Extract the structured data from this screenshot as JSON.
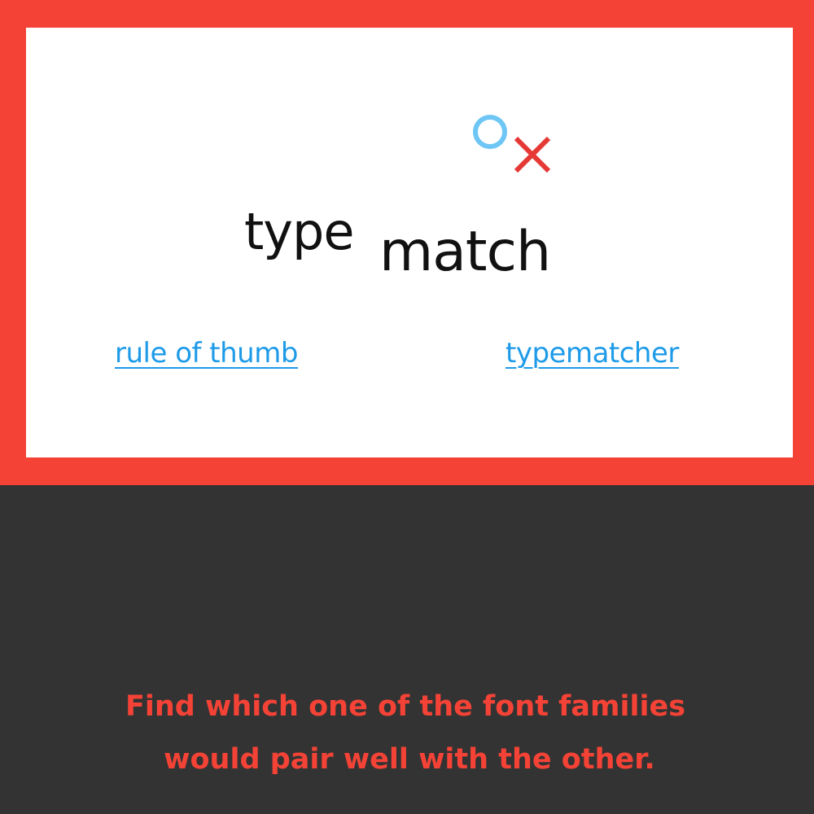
{
  "header": {
    "logo": {
      "word1": "type",
      "word2": "match",
      "icon": "o-x-icon",
      "icon_colors": {
        "circle": "#6ec6f5",
        "cross": "#e53935"
      }
    },
    "nav": {
      "rule_of_thumb_label": "rule of thumb",
      "typematcher_label": "typematcher"
    }
  },
  "main": {
    "tagline_line1": "Find which one of the font families",
    "tagline_line2": "would pair well with the other."
  },
  "colors": {
    "frame": "#f44336",
    "panel": "#ffffff",
    "background": "#333333",
    "link": "#1e9be8",
    "tagline": "#f44336"
  }
}
